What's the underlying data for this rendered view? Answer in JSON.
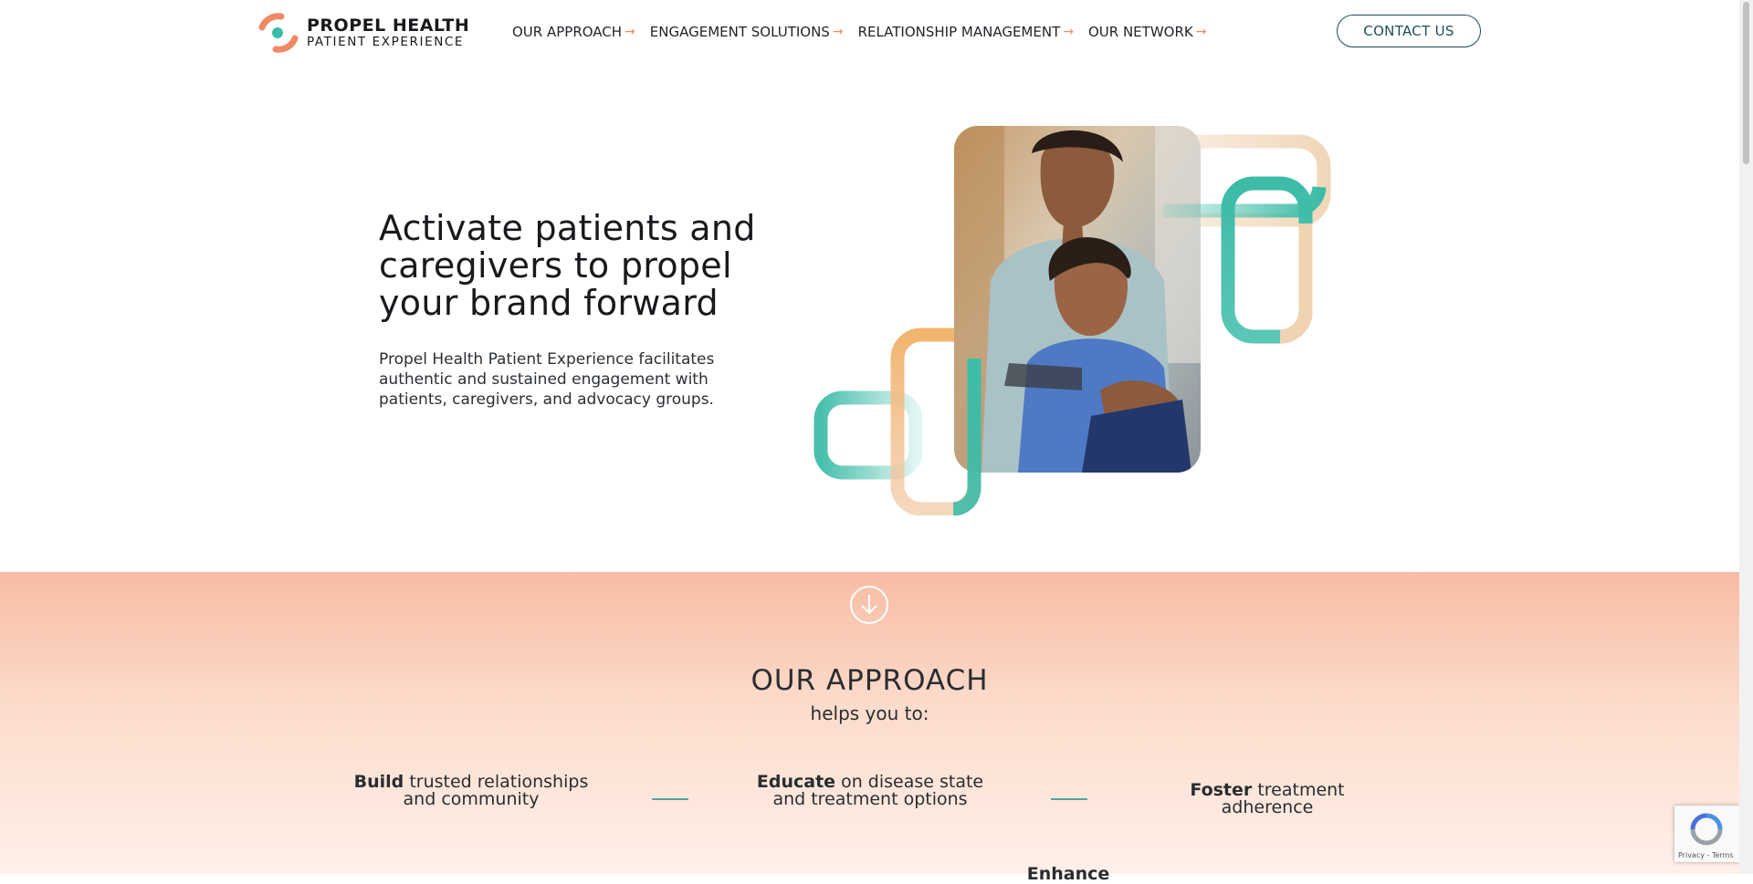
{
  "header": {
    "logo": {
      "name": "PROPEL HEALTH",
      "sub": "PATIENT EXPERIENCE"
    },
    "nav": [
      {
        "label": "OUR APPROACH"
      },
      {
        "label": "ENGAGEMENT SOLUTIONS"
      },
      {
        "label": "RELATIONSHIP MANAGEMENT"
      },
      {
        "label": "OUR NETWORK"
      }
    ],
    "nav_arrow_icon": "arrow-right-icon",
    "contact_label": "CONTACT US"
  },
  "hero": {
    "title": "Activate patients and caregivers to propel your brand forward",
    "subtitle": "Propel Health Patient Experience facilitates authentic and sustained engagement with patients, caregivers, and advocacy groups."
  },
  "approach": {
    "title": "OUR APPROACH",
    "subtitle": "helps you to:",
    "scroll_icon": "arrow-down-circle-icon",
    "benefits": [
      {
        "bold": "Build",
        "rest": " trusted relationships and community"
      },
      {
        "bold": "Educate",
        "rest": " on disease state and treatment options"
      },
      {
        "bold": "Foster",
        "rest": " treatment adherence"
      },
      {
        "bold": "Enhance",
        "rest": ""
      }
    ]
  },
  "recaptcha": {
    "text": "Privacy - Terms",
    "icon": "recaptcha-icon"
  },
  "colors": {
    "accent_orange": "#f08a64",
    "accent_teal": "#3dbca8",
    "brand_dark_teal": "#1e4d5a",
    "section_peach": "#f8bca3"
  }
}
